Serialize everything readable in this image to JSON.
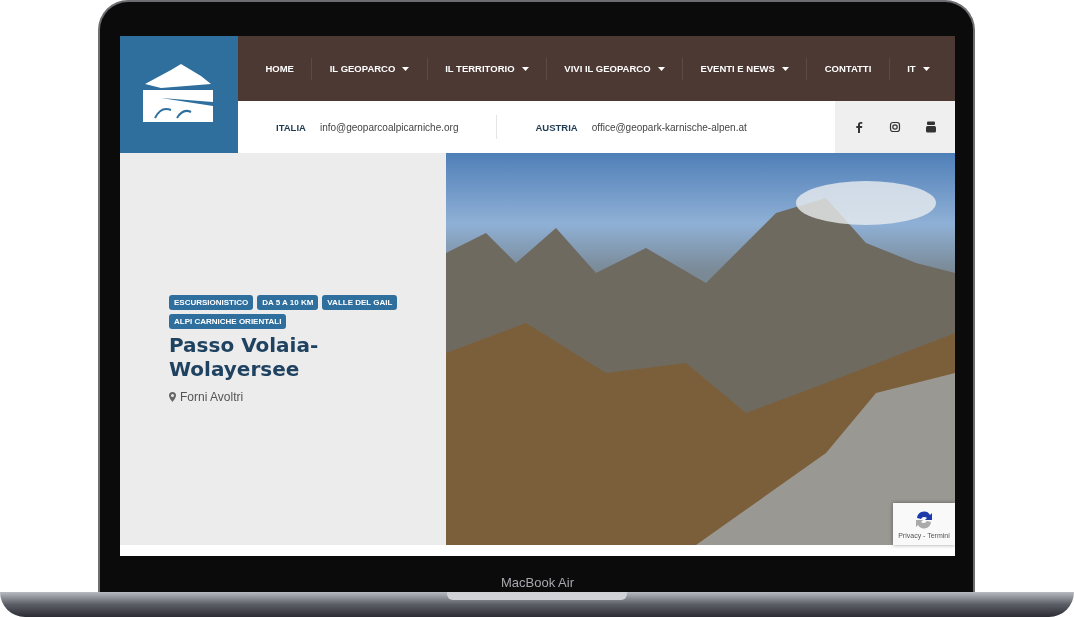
{
  "nav": {
    "items": [
      {
        "label": "HOME",
        "dropdown": false
      },
      {
        "label": "IL GEOPARCO",
        "dropdown": true
      },
      {
        "label": "IL TERRITORIO",
        "dropdown": true
      },
      {
        "label": "VIVI IL GEOPARCO",
        "dropdown": true
      },
      {
        "label": "EVENTI E NEWS",
        "dropdown": true
      },
      {
        "label": "CONTATTI",
        "dropdown": false
      },
      {
        "label": "IT",
        "dropdown": true
      }
    ]
  },
  "contacts": [
    {
      "country": "ITALIA",
      "email": "info@geoparcoalpicarniche.org"
    },
    {
      "country": "AUSTRIA",
      "email": "office@geopark-karnische-alpen.at"
    }
  ],
  "hero": {
    "tags": [
      "ESCURSIONISTICO",
      "DA 5 A 10 KM",
      "VALLE DEL GAIL",
      "ALPI CARNICHE ORIENTALI"
    ],
    "title": "Passo Volaia-Wolayersee",
    "location": "Forni Avoltri"
  },
  "recaptcha": {
    "links": "Privacy - Termini"
  },
  "device": {
    "label": "MacBook Air"
  }
}
